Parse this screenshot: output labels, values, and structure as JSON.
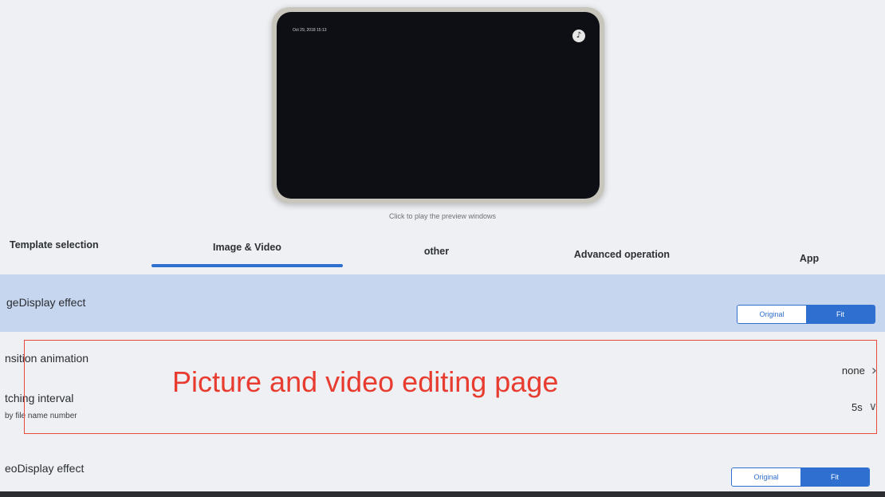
{
  "preview": {
    "screen_time": "Oct 29, 2018 15:13",
    "hint": "Click to play the preview windows",
    "music_icon": "music-note-icon"
  },
  "tabs": [
    {
      "label": "Template selection",
      "active": false
    },
    {
      "label": "Image & Video",
      "active": true
    },
    {
      "label": "other",
      "active": false
    },
    {
      "label": "Advanced operation",
      "active": false
    },
    {
      "label": "App",
      "active": false
    }
  ],
  "settings": {
    "image_display": {
      "title": "geDisplay effect",
      "options": [
        "Original",
        "Fit"
      ],
      "selected": "Fit"
    },
    "transition": {
      "title": "nsition animation",
      "value": "none"
    },
    "switching": {
      "title": "tching interval",
      "subtitle": "by file name number",
      "value": "5s"
    },
    "video_display": {
      "title": "eoDisplay effect",
      "options": [
        "Original",
        "Fit"
      ],
      "selected": "Fit"
    }
  },
  "annotation": {
    "text": "Picture and video editing page",
    "color": "#e83c30"
  },
  "colors": {
    "accent": "#2f6fd0",
    "highlight_row": "#c6d6ef"
  }
}
